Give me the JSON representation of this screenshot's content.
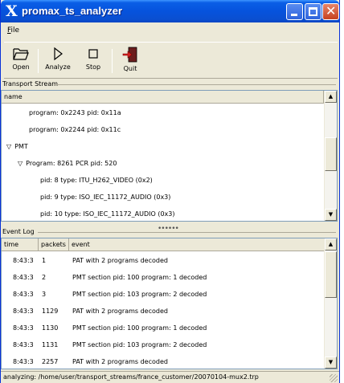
{
  "window": {
    "app_icon": "X",
    "title": "promax_ts_analyzer"
  },
  "menu": {
    "file_label": "File"
  },
  "toolbar": {
    "open_label": "Open",
    "analyze_label": "Analyze",
    "stop_label": "Stop",
    "quit_label": "Quit"
  },
  "transport_stream": {
    "group_label": "Transport Stream",
    "column_name": "name",
    "rows": [
      {
        "text": "program: 0x2243 pid: 0x11a",
        "indent": 2,
        "expander": ""
      },
      {
        "text": "program: 0x2244 pid: 0x11c",
        "indent": 2,
        "expander": ""
      },
      {
        "text": "PMT",
        "indent": 0,
        "expander": "▽"
      },
      {
        "text": "Program: 8261 PCR pid: 520",
        "indent": 1,
        "expander": "▽"
      },
      {
        "text": "pid: 8 type: ITU_H262_VIDEO (0x2)",
        "indent": 3,
        "expander": ""
      },
      {
        "text": "pid: 9 type: ISO_IEC_11172_AUDIO (0x3)",
        "indent": 3,
        "expander": ""
      },
      {
        "text": "pid: 10 type: ISO_IEC_11172_AUDIO (0x3)",
        "indent": 3,
        "expander": ""
      }
    ]
  },
  "pane_divider_grip": "••••••",
  "event_log": {
    "group_label": "Event Log",
    "columns": [
      "time",
      "packets",
      "event"
    ],
    "rows": [
      {
        "time": "8:43:3",
        "packets": "1",
        "event": "PAT with 2 programs decoded"
      },
      {
        "time": "8:43:3",
        "packets": "2",
        "event": "PMT section pid: 100 program: 1 decoded"
      },
      {
        "time": "8:43:3",
        "packets": "3",
        "event": "PMT section pid: 103 program: 2 decoded"
      },
      {
        "time": "8:43:3",
        "packets": "1129",
        "event": "PAT with 2 programs decoded"
      },
      {
        "time": "8:43:3",
        "packets": "1130",
        "event": "PMT section pid: 100 program: 1 decoded"
      },
      {
        "time": "8:43:3",
        "packets": "1131",
        "event": "PMT section pid: 103 program: 2 decoded"
      },
      {
        "time": "8:43:3",
        "packets": "2257",
        "event": "PAT with 2 programs decoded"
      }
    ]
  },
  "status": {
    "text": "analyzing: /home/user/transport_streams/france_customer/20070104-mux2.trp"
  },
  "icons": {
    "open": "folder-open-icon",
    "analyze": "play-icon",
    "stop": "stop-icon",
    "quit": "quit-door-icon"
  },
  "colors": {
    "titlebar": "#0653dd",
    "close_button": "#c6401e",
    "chrome": "#ece9d8"
  }
}
